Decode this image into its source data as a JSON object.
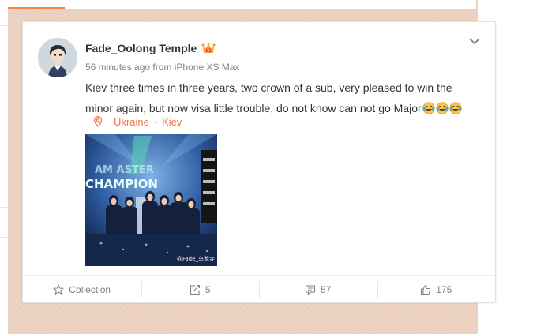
{
  "post": {
    "username": "Fade_Oolong Temple",
    "timestamp": "56 minutes ago",
    "source_prefix": "from",
    "source": "iPhone XS Max",
    "text": "Kiev three times in three years, two crown of a sub, very pleased to win the minor again, but now visa little trouble, do not know can not go Major",
    "emojis": [
      "laugh-cry-emoji",
      "laugh-cry-emoji",
      "laugh-cry-emoji"
    ],
    "location": {
      "country": "Ukraine",
      "separator": "·",
      "city": "Kiev"
    },
    "image": {
      "banner_text": "CHAMPION",
      "watermark": "@Fade_乌龙寺"
    }
  },
  "actions": {
    "collection_label": "Collection",
    "repost_count": "5",
    "comment_count": "57",
    "like_count": "175"
  },
  "icons": {
    "vip": "vip-crown-icon",
    "menu": "chevron-down-icon",
    "location": "location-pin-icon",
    "collection": "star-icon",
    "repost": "repost-icon",
    "comment": "comment-icon",
    "like": "thumbs-up-icon"
  },
  "colors": {
    "accent": "#eb7350",
    "background": "#ebd0bf",
    "tab_accent": "#ff8140",
    "text": "#333333",
    "muted": "#808080"
  }
}
